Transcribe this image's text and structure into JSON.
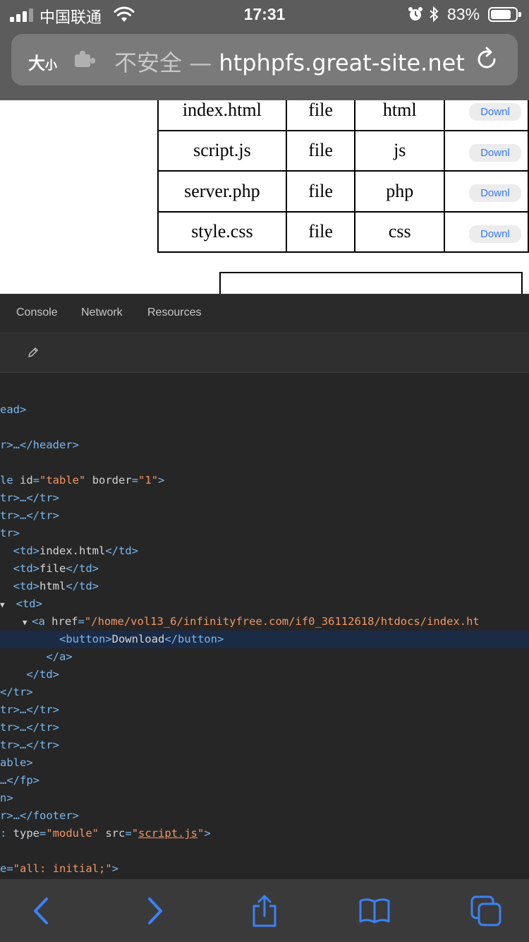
{
  "status_bar": {
    "carrier": "中国联通",
    "time": "17:31",
    "battery_percent": "83%",
    "battery_level": 0.83
  },
  "url_bar": {
    "text_size_big": "大",
    "text_size_small": "小",
    "security": "不安全",
    "separator": " — ",
    "domain": "htphpfs.great-site.net"
  },
  "page": {
    "rows": [
      {
        "name": "index.html",
        "type": "file",
        "ext": "html",
        "button": "Downl"
      },
      {
        "name": "script.js",
        "type": "file",
        "ext": "js",
        "button": "Downl"
      },
      {
        "name": "server.php",
        "type": "file",
        "ext": "php",
        "button": "Downl"
      },
      {
        "name": "style.css",
        "type": "file",
        "ext": "css",
        "button": "Downl"
      }
    ]
  },
  "devtools": {
    "tabs": [
      "Console",
      "Network",
      "Resources"
    ],
    "code": {
      "l1": "ead>",
      "l2a": "r>…</header>",
      "l3_tag": "le ",
      "l3_a1": "id",
      "l3_v1": "\"table\"",
      "l3_a2": "border",
      "l3_v2": "\"1\"",
      "tr_collapsed": "tr>…</tr>",
      "tr_open": "tr>",
      "td1": "index.html",
      "td2": "file",
      "td3": "html",
      "td_tag": "<td>",
      "a_tag": "<a ",
      "a_attr": "href",
      "a_val": "\"/home/vol13_6/infinityfree.com/if0_36112618/htdocs/index.ht",
      "btn_text": "Download",
      "close_a": "</a>",
      "close_td": "</td>",
      "close_tr": "</tr>",
      "close_table": "able>",
      "fp": "…</fp>",
      "n_close": "n>",
      "footer": "r>…</footer>",
      "script_type_attr": "type",
      "script_type_val": "\"module\"",
      "script_src_attr": "src",
      "script_src_val": "script.js",
      "style_val": "e=\"all: initial;\">"
    }
  }
}
